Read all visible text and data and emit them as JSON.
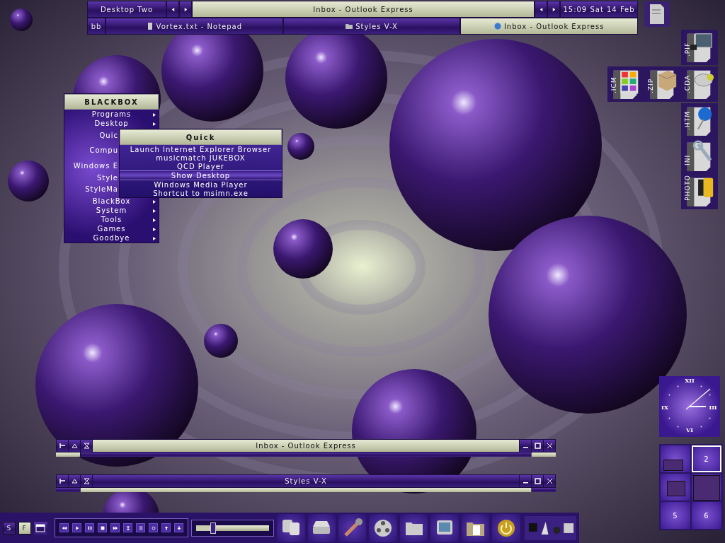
{
  "toolbar": {
    "workspace": "Desktop Two",
    "current_window": "Inbox - Outlook Express",
    "clock": "15:09 Sat 14 Feb",
    "pager_label": "bb",
    "tasks": [
      {
        "label": "Vortex.txt - Notepad",
        "selected": false
      },
      {
        "label": "Styles V-X",
        "selected": false
      },
      {
        "label": "Inbox - Outlook Express",
        "selected": true
      }
    ]
  },
  "menu": {
    "title": "BLACKBOX",
    "items": [
      {
        "label": "Programs",
        "submenu": true
      },
      {
        "label": "Desktop",
        "submenu": true
      },
      {
        "label": "Quic",
        "submenu": false
      },
      {
        "label": "Compu",
        "submenu": false
      },
      {
        "label": "Windows E",
        "submenu": false
      },
      {
        "label": "Style",
        "submenu": false
      },
      {
        "label": "StyleMa",
        "submenu": false
      },
      {
        "label": "BlackBox",
        "submenu": true
      },
      {
        "label": "System",
        "submenu": true
      },
      {
        "label": "Tools",
        "submenu": true
      },
      {
        "label": "Games",
        "submenu": true
      },
      {
        "label": "Goodbye",
        "submenu": true
      }
    ]
  },
  "submenu": {
    "title": "Quick",
    "items": [
      {
        "label": "Launch Internet Explorer Browser",
        "selected": false
      },
      {
        "label": "musicmatch JUKEBOX",
        "selected": false
      },
      {
        "label": "QCD Player",
        "selected": false
      },
      {
        "label": "Show Desktop",
        "selected": true
      },
      {
        "label": "Windows Media Player",
        "selected": false
      },
      {
        "label": "Shortcut to msimn.exe",
        "selected": false
      }
    ]
  },
  "desktop_icons": [
    {
      "label": ".PIF",
      "kind": "console"
    },
    {
      "label": ".ICM",
      "kind": "palette"
    },
    {
      "label": ".ZIP",
      "kind": "box"
    },
    {
      "label": ".CDA",
      "kind": "disc"
    },
    {
      "label": ".HTM",
      "kind": "pin"
    },
    {
      "label": "INI",
      "kind": "wrench"
    },
    {
      "label": "PHOTO",
      "kind": "film"
    }
  ],
  "windows": [
    {
      "title": "Inbox - Outlook Express",
      "focused": true
    },
    {
      "title": "Styles V-X",
      "focused": false
    }
  ],
  "clock": {
    "numerals": [
      "XII",
      "III",
      "VI",
      "IX"
    ]
  },
  "pager": {
    "desks": [
      {
        "selected": false
      },
      {
        "label": "2",
        "selected": true
      },
      {
        "selected": false
      },
      {
        "selected": false
      },
      {
        "label": "5",
        "selected": false
      },
      {
        "label": "6",
        "selected": false
      }
    ]
  },
  "slit": {
    "buttons": [
      "S",
      "F"
    ],
    "volume": {
      "level": 0.22
    }
  }
}
